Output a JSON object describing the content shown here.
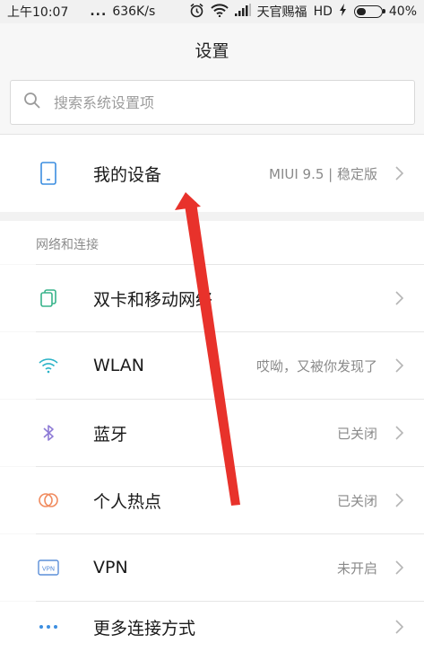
{
  "status_bar": {
    "time": "上午10:07",
    "dots": "...",
    "net_speed": "636K/s",
    "carrier": "天官赐福",
    "network_type": "HD",
    "battery_percent": "40%",
    "battery_level": 0.4,
    "icons": [
      "alarm-icon",
      "wifi-icon",
      "signal-icon",
      "battery-icon"
    ]
  },
  "header": {
    "title": "设置"
  },
  "search": {
    "placeholder": "搜索系统设置项"
  },
  "device": {
    "label": "我的设备",
    "value": "MIUI 9.5 | 稳定版",
    "icon": "phone-icon"
  },
  "network_section": {
    "title": "网络和连接",
    "items": [
      {
        "label": "双卡和移动网络",
        "value": "",
        "icon": "sim-card-icon"
      },
      {
        "label": "WLAN",
        "value": "哎呦，又被你发现了",
        "icon": "wifi-icon"
      },
      {
        "label": "蓝牙",
        "value": "已关闭",
        "icon": "bluetooth-icon"
      },
      {
        "label": "个人热点",
        "value": "已关闭",
        "icon": "hotspot-icon"
      },
      {
        "label": "VPN",
        "value": "未开启",
        "icon": "vpn-icon"
      },
      {
        "label": "更多连接方式",
        "value": "",
        "icon": "more-dots-icon"
      }
    ]
  },
  "colors": {
    "accent_blue": "#3c8ee0",
    "sim_green": "#38b48b",
    "wifi_teal": "#2bb3c7",
    "bluetooth_purple": "#8e7bd6",
    "hotspot_orange": "#f08a5d",
    "vpn_blue": "#5b8fd9",
    "annotation_arrow": "#e8322b"
  }
}
